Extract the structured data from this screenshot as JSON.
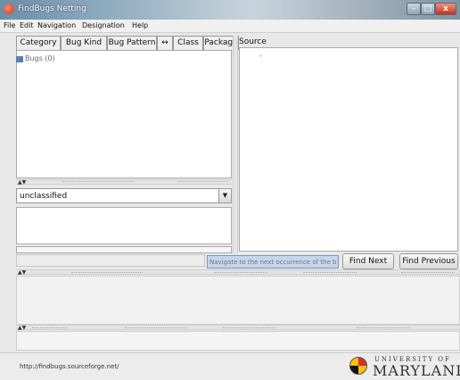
{
  "window": {
    "title": "FindBugs Netting"
  },
  "menu": [
    "File",
    "Edit",
    "Navigation",
    "Designation",
    "Help"
  ],
  "tabs": [
    "Category",
    "Bug Kind",
    "Bug Pattern",
    "↔",
    "Class",
    "Package"
  ],
  "tree": {
    "root_label": "Bugs (0)"
  },
  "designation": {
    "selected": "unclassified"
  },
  "source": {
    "label": "Source"
  },
  "search": {
    "placeholder": "Navigate to the next occurrence of the bug pattern"
  },
  "buttons": {
    "find_next": "Find Next",
    "find_previous": "Find Previous"
  },
  "status": {
    "url": "http://findbugs.sourceforge.net/"
  },
  "logo": {
    "line1": "UNIVERSITY OF",
    "line2": "MARYLAND"
  }
}
